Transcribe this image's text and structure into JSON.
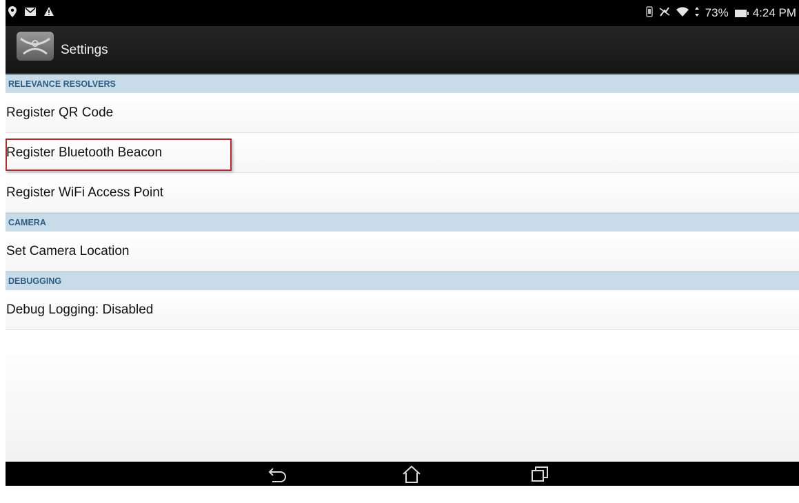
{
  "status_bar": {
    "left_icons": [
      "location-pin-icon",
      "mail-icon",
      "warning-icon"
    ],
    "right_icons": [
      "vibrate-icon",
      "mute-icon",
      "wifi-icon",
      "data-arrows-icon",
      "battery-icon"
    ],
    "battery": "73%",
    "time": "4:24 PM"
  },
  "action_bar": {
    "icon": "app-logo-icon",
    "title": "Settings"
  },
  "sections": {
    "relevance": {
      "header": "RELEVANCE RESOLVERS",
      "items": [
        "Register QR Code",
        "Register Bluetooth Beacon",
        "Register WiFi Access Point"
      ]
    },
    "camera": {
      "header": "CAMERA",
      "items": [
        "Set Camera Location"
      ]
    },
    "debugging": {
      "header": "DEBUGGING",
      "items": [
        "Debug Logging: Disabled"
      ]
    }
  },
  "nav_bar": {
    "buttons": [
      "back-icon",
      "home-icon",
      "recents-icon"
    ]
  },
  "colors": {
    "section_bg": "#c8dbe8",
    "section_text": "#2c5b84",
    "highlight_border": "#b02d2d"
  }
}
